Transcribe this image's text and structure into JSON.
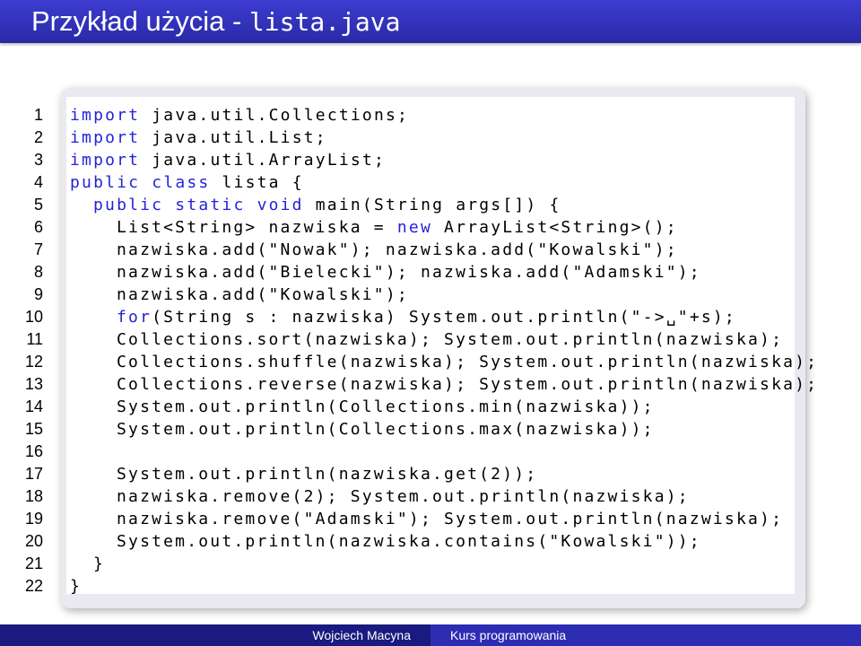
{
  "slide": {
    "title_text": "Przykład użycia - ",
    "title_code": "lista.java"
  },
  "code": {
    "lines": [
      {
        "num": "1",
        "indent": 0,
        "parts": [
          {
            "t": "import",
            "kw": true
          },
          {
            "t": " java.util.Collections;"
          }
        ]
      },
      {
        "num": "2",
        "indent": 0,
        "parts": [
          {
            "t": "import",
            "kw": true
          },
          {
            "t": " java.util.List;"
          }
        ]
      },
      {
        "num": "3",
        "indent": 0,
        "parts": [
          {
            "t": "import",
            "kw": true
          },
          {
            "t": " java.util.ArrayList;"
          }
        ]
      },
      {
        "num": "4",
        "indent": 0,
        "parts": [
          {
            "t": "public",
            "kw": true
          },
          {
            "t": " "
          },
          {
            "t": "class",
            "kw": true
          },
          {
            "t": " lista {"
          }
        ]
      },
      {
        "num": "5",
        "indent": 1,
        "parts": [
          {
            "t": "public",
            "kw": true
          },
          {
            "t": " "
          },
          {
            "t": "static",
            "kw": true
          },
          {
            "t": " "
          },
          {
            "t": "void",
            "kw": true
          },
          {
            "t": " main(String args[]) {"
          }
        ]
      },
      {
        "num": "6",
        "indent": 2,
        "parts": [
          {
            "t": "List<String> nazwiska = "
          },
          {
            "t": "new",
            "kw": true
          },
          {
            "t": " ArrayList<String>();"
          }
        ]
      },
      {
        "num": "7",
        "indent": 2,
        "parts": [
          {
            "t": "nazwiska.add(\"Nowak\"); nazwiska.add(\"Kowalski\");"
          }
        ]
      },
      {
        "num": "8",
        "indent": 2,
        "parts": [
          {
            "t": "nazwiska.add(\"Bielecki\"); nazwiska.add(\"Adamski\");"
          }
        ]
      },
      {
        "num": "9",
        "indent": 2,
        "parts": [
          {
            "t": "nazwiska.add(\"Kowalski\");"
          }
        ]
      },
      {
        "num": "10",
        "indent": 2,
        "parts": [
          {
            "t": "for",
            "kw": true
          },
          {
            "t": "(String s : nazwiska) System.out.println(\"->␣\"+s);"
          }
        ]
      },
      {
        "num": "11",
        "indent": 2,
        "parts": [
          {
            "t": "Collections.sort(nazwiska); System.out.println(nazwiska);"
          }
        ]
      },
      {
        "num": "12",
        "indent": 2,
        "parts": [
          {
            "t": "Collections.shuffle(nazwiska); System.out.println(nazwiska);"
          }
        ]
      },
      {
        "num": "13",
        "indent": 2,
        "parts": [
          {
            "t": "Collections.reverse(nazwiska); System.out.println(nazwiska);"
          }
        ]
      },
      {
        "num": "14",
        "indent": 2,
        "parts": [
          {
            "t": "System.out.println(Collections.min(nazwiska));"
          }
        ]
      },
      {
        "num": "15",
        "indent": 2,
        "parts": [
          {
            "t": "System.out.println(Collections.max(nazwiska));"
          }
        ]
      },
      {
        "num": "16",
        "indent": 0,
        "parts": []
      },
      {
        "num": "17",
        "indent": 2,
        "parts": [
          {
            "t": "System.out.println(nazwiska.get(2));"
          }
        ]
      },
      {
        "num": "18",
        "indent": 2,
        "parts": [
          {
            "t": "nazwiska.remove(2); System.out.println(nazwiska);"
          }
        ]
      },
      {
        "num": "19",
        "indent": 2,
        "parts": [
          {
            "t": "nazwiska.remove(\"Adamski\"); System.out.println(nazwiska);"
          }
        ]
      },
      {
        "num": "20",
        "indent": 2,
        "parts": [
          {
            "t": "System.out.println(nazwiska.contains(\"Kowalski\"));"
          }
        ]
      },
      {
        "num": "21",
        "indent": 1,
        "parts": [
          {
            "t": "}"
          }
        ]
      },
      {
        "num": "22",
        "indent": 0,
        "parts": [
          {
            "t": "}"
          }
        ]
      }
    ]
  },
  "footer": {
    "author": "Wojciech Macyna",
    "course": "Kurs programowania"
  },
  "colors": {
    "header_bg": "#3434c8",
    "keyword": "#2323d8",
    "footer_left_bg": "#1a1a80",
    "footer_right_bg": "#2d2db4"
  }
}
